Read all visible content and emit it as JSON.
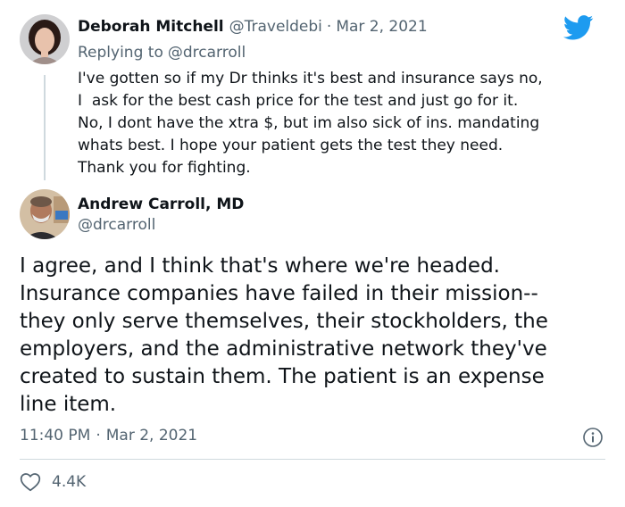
{
  "reply_tweet": {
    "author_name": "Deborah Mitchell",
    "author_handle": "@Traveldebi",
    "separator": "·",
    "date": "Mar 2, 2021",
    "replying_to_label": "Replying to",
    "replying_to_handle": "@drcarroll",
    "lines": [
      "I've gotten so if my Dr thinks it's best and insurance says no,",
      "I  ask for the best cash price for the test and just go for it.",
      "No, I dont have the xtra $, but im also sick of ins. mandating",
      "whats best. I hope your patient gets the test they need.",
      "Thank you for fighting."
    ]
  },
  "main_tweet": {
    "author_name": "Andrew Carroll, MD",
    "author_handle": "@drcarroll",
    "lines": [
      "I agree, and I think that's where we're headed.",
      "Insurance companies have failed in their mission--",
      "they only serve themselves, their stockholders, the",
      "employers, and the administrative network they've",
      "created to sustain them. The patient is an expense",
      "line item."
    ],
    "time": "11:40 PM",
    "separator": "·",
    "date": "Mar 2, 2021",
    "like_count": "4.4K"
  },
  "icons": {
    "brand": "twitter-bird-icon",
    "info": "info-icon",
    "like": "heart-icon"
  },
  "colors": {
    "brand_blue": "#1d9bf0",
    "text": "#0f1419",
    "muted": "#536471",
    "divider": "#cfd9de"
  }
}
